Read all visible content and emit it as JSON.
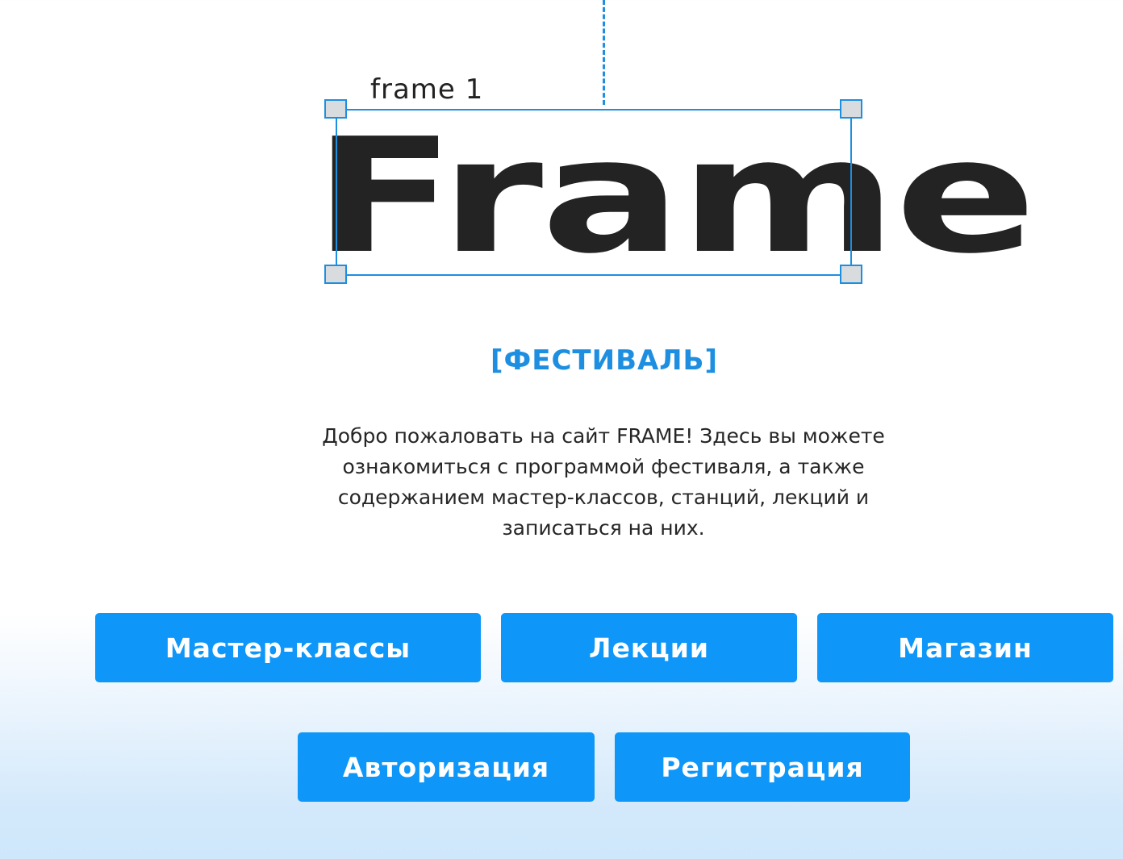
{
  "canvas": {
    "frame_label": "frame 1",
    "logo_text": "Frame"
  },
  "hero": {
    "tagline": "[ФЕСТИВАЛЬ]",
    "intro_text": "Добро пожаловать на сайт FRAME! Здесь вы можете ознакомиться с программой фестиваля, а также содержанием мастер-классов, станций, лекций и записаться на них."
  },
  "nav": {
    "master_classes": "Мастер-классы",
    "lectures": "Лекции",
    "shop": "Магазин",
    "login": "Авторизация",
    "register": "Регистрация"
  },
  "colors": {
    "accent": "#0e97f8",
    "selection": "#1e8fe0",
    "text_dark": "#232323",
    "gradient_bottom": "#cfe7fb"
  }
}
